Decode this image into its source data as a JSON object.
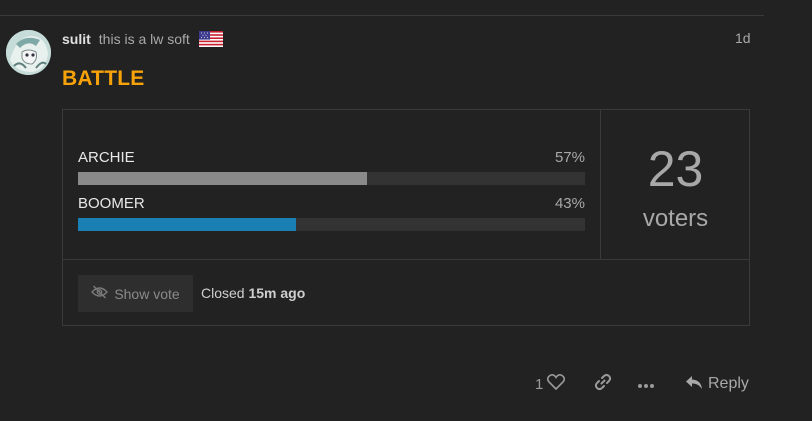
{
  "post": {
    "username": "sulit",
    "user_title": "this is a lw soft",
    "date": "1d",
    "title": "BATTLE",
    "flag_icon": "us-flag-icon"
  },
  "poll": {
    "options": [
      {
        "name": "ARCHIE",
        "percent_label": "57%",
        "percent": 57,
        "bar_color": "#8a8a8a"
      },
      {
        "name": "BOOMER",
        "percent_label": "43%",
        "percent": 43,
        "bar_color": "#1a7fb3"
      }
    ],
    "voters_count": "23",
    "voters_label": "voters",
    "show_vote_label": "Show vote",
    "closed_prefix": "Closed",
    "closed_time": "15m ago"
  },
  "actions": {
    "like_count": "1",
    "reply_label": "Reply"
  },
  "colors": {
    "accent_title": "#f6a208",
    "background": "#222222"
  }
}
